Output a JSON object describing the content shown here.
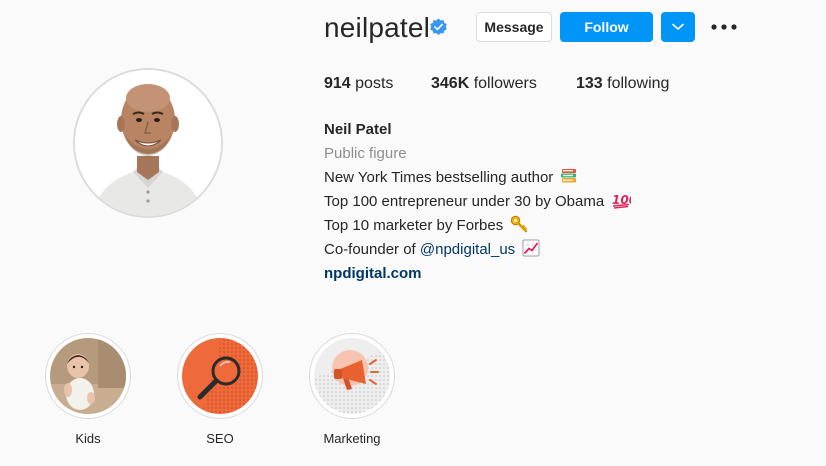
{
  "profile": {
    "username": "neilpatel",
    "verified": true,
    "buttons": {
      "message": "Message",
      "follow": "Follow"
    },
    "stats": {
      "posts_count": "914",
      "posts_label": "posts",
      "followers_count": "346K",
      "followers_label": "followers",
      "following_count": "133",
      "following_label": "following"
    },
    "bio": {
      "name": "Neil Patel",
      "category": "Public figure",
      "line1": "New York Times bestselling author",
      "line2": "Top 100 entrepreneur under 30 by Obama",
      "line3": "Top 10 marketer by Forbes",
      "line4_prefix": "Co-founder of ",
      "line4_mention": "@npdigital_us",
      "website": "npdigital.com"
    }
  },
  "highlights": [
    {
      "label": "Kids"
    },
    {
      "label": "SEO"
    },
    {
      "label": "Marketing"
    }
  ],
  "icons": {
    "verified": "verified-badge-icon",
    "dropdown": "chevron-down-icon",
    "more": "more-options-icon",
    "books": "books-emoji-icon",
    "hundred": "hundred-points-emoji-icon",
    "key": "key-emoji-icon",
    "chart": "chart-increasing-emoji-icon"
  },
  "colors": {
    "accent": "#0095f6",
    "link": "#00376b",
    "muted": "#8e8e8e",
    "background": "#fafafa"
  }
}
